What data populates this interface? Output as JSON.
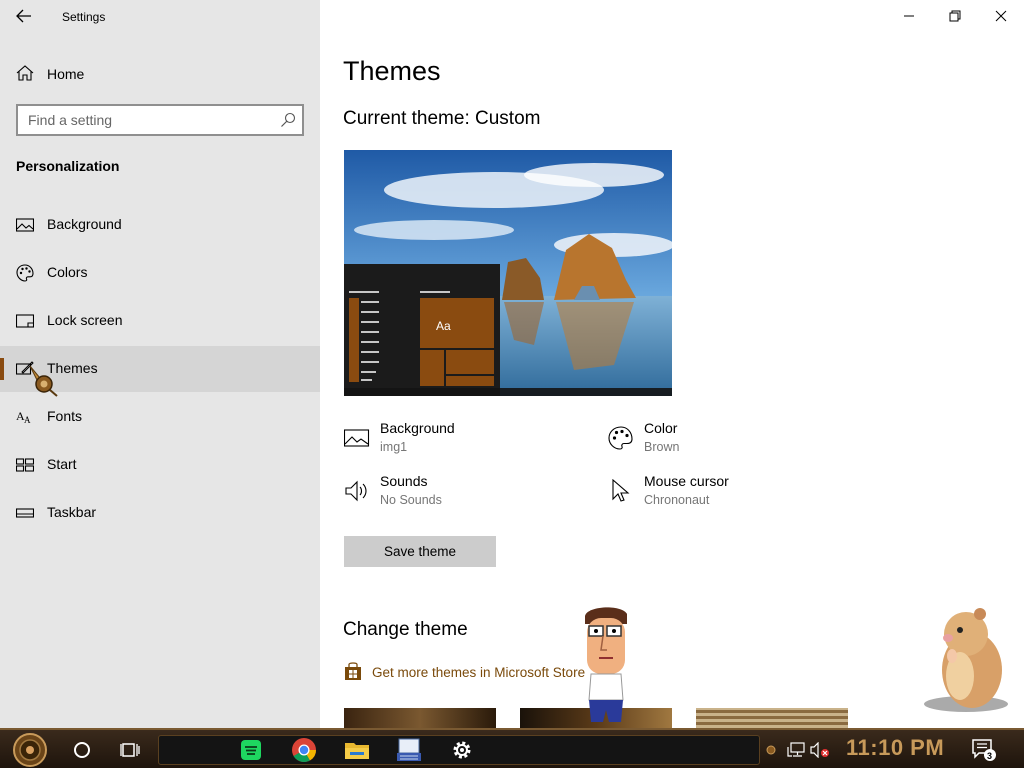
{
  "app": {
    "title": "Settings"
  },
  "sidebar": {
    "home_label": "Home",
    "search_placeholder": "Find a setting",
    "section_title": "Personalization",
    "items": [
      {
        "label": "Background",
        "icon": "image-icon"
      },
      {
        "label": "Colors",
        "icon": "palette-icon"
      },
      {
        "label": "Lock screen",
        "icon": "lock-screen-icon"
      },
      {
        "label": "Themes",
        "icon": "themes-icon",
        "active": true
      },
      {
        "label": "Fonts",
        "icon": "fonts-icon"
      },
      {
        "label": "Start",
        "icon": "start-icon"
      },
      {
        "label": "Taskbar",
        "icon": "taskbar-icon"
      }
    ]
  },
  "main": {
    "title": "Themes",
    "current_theme_label": "Current theme:",
    "current_theme_name": "Custom",
    "preview_tile_text": "Aa",
    "properties": {
      "background": {
        "label": "Background",
        "value": "img1"
      },
      "color": {
        "label": "Color",
        "value": "Brown"
      },
      "sounds": {
        "label": "Sounds",
        "value": "No Sounds"
      },
      "mouse_cursor": {
        "label": "Mouse cursor",
        "value": "Chrononaut"
      }
    },
    "save_button": "Save theme",
    "change_theme_title": "Change theme",
    "store_link": "Get more themes in Microsoft Store"
  },
  "taskbar": {
    "clock": "11:10 PM",
    "notification_count": "3"
  },
  "colors": {
    "accent": "#8a4b10",
    "link": "#7a4a0b",
    "sidebar_bg": "#e6e6e6",
    "active_item_bg": "#d5d5d5"
  }
}
